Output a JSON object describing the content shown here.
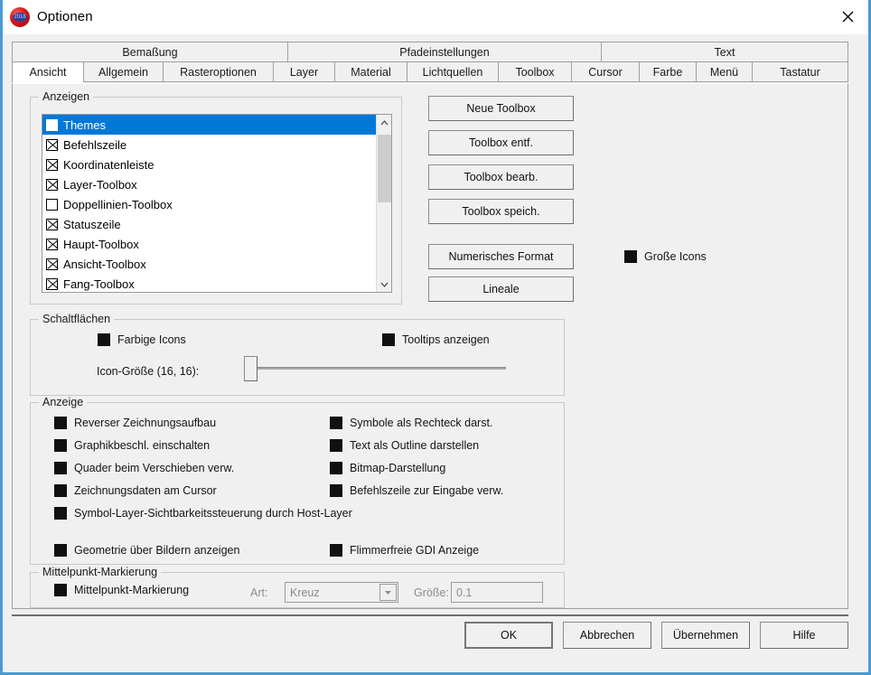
{
  "window": {
    "title": "Optionen",
    "icon": "app-logo-icon",
    "icon_label": "2018",
    "close_label": "close-icon",
    "accent_color": "#4a9bd1"
  },
  "tabs": {
    "row1": [
      {
        "label": "Bemaßung",
        "active": false
      },
      {
        "label": "Pfadeinstellungen",
        "active": false
      },
      {
        "label": "Text",
        "active": false
      }
    ],
    "row2": [
      {
        "label": "Ansicht",
        "active": true
      },
      {
        "label": "Allgemein",
        "active": false
      },
      {
        "label": "Rasteroptionen",
        "active": false
      },
      {
        "label": "Layer",
        "active": false
      },
      {
        "label": "Material",
        "active": false
      },
      {
        "label": "Lichtquellen",
        "active": false
      },
      {
        "label": "Toolbox",
        "active": false
      },
      {
        "label": "Cursor",
        "active": false
      },
      {
        "label": "Farbe",
        "active": false
      },
      {
        "label": "Menü",
        "active": false
      },
      {
        "label": "Tastatur",
        "active": false
      }
    ]
  },
  "anzeigen_group": {
    "title": "Anzeigen",
    "items": [
      {
        "label": "Themes",
        "checked": false,
        "selected": true
      },
      {
        "label": "Befehlszeile",
        "checked": true,
        "selected": false
      },
      {
        "label": "Koordinatenleiste",
        "checked": true,
        "selected": false
      },
      {
        "label": "Layer-Toolbox",
        "checked": true,
        "selected": false
      },
      {
        "label": "Doppellinien-Toolbox",
        "checked": false,
        "selected": false
      },
      {
        "label": "Statuszeile",
        "checked": true,
        "selected": false
      },
      {
        "label": "Haupt-Toolbox",
        "checked": true,
        "selected": false
      },
      {
        "label": "Ansicht-Toolbox",
        "checked": true,
        "selected": false
      },
      {
        "label": "Fang-Toolbox",
        "checked": true,
        "selected": false
      }
    ],
    "scroll_up": "▲",
    "scroll_down": "▼"
  },
  "toolbox_buttons": [
    {
      "label": "Neue Toolbox"
    },
    {
      "label": "Toolbox entf."
    },
    {
      "label": "Toolbox bearb."
    },
    {
      "label": "Toolbox speich."
    },
    {
      "label": "Numerisches Format"
    },
    {
      "label": "Lineale"
    }
  ],
  "grosse_icons": {
    "label": "Große Icons",
    "checked": true
  },
  "schaltflaechen_group": {
    "title": "Schaltflächen",
    "farbige_icons": {
      "label": "Farbige Icons",
      "checked": true
    },
    "tooltips": {
      "label": "Tooltips anzeigen",
      "checked": true
    },
    "icon_size_label": "Icon-Größe (16, 16):",
    "icon_size_value": 16,
    "icon_size_min": 16,
    "icon_size_max": 64
  },
  "anzeige_group": {
    "title": "Anzeige",
    "left_column": [
      {
        "label": "Reverser Zeichnungsaufbau",
        "checked": true
      },
      {
        "label": "Graphikbeschl. einschalten",
        "checked": true
      },
      {
        "label": "Quader beim Verschieben verw.",
        "checked": true
      },
      {
        "label": "Zeichnungsdaten am Cursor",
        "checked": true
      },
      {
        "label": "Symbol-Layer-Sichtbarkeitssteuerung durch Host-Layer",
        "checked": true
      }
    ],
    "right_column": [
      {
        "label": "Symbole als Rechteck darst.",
        "checked": true
      },
      {
        "label": "Text als Outline darstellen",
        "checked": true
      },
      {
        "label": "Bitmap-Darstellung",
        "checked": true
      },
      {
        "label": "Befehlszeile zur Eingabe verw.",
        "checked": true
      }
    ],
    "bottom_left": {
      "label": "Geometrie über Bildern anzeigen",
      "checked": true
    },
    "bottom_right": {
      "label": "Flimmerfreie GDI Anzeige",
      "checked": true
    }
  },
  "mittelpunkt_group": {
    "title": "Mittelpunkt-Markierung",
    "checkbox": {
      "label": "Mittelpunkt-Markierung",
      "checked": true
    },
    "art_label": "Art:",
    "art_value": "Kreuz",
    "art_options": [
      "Kreuz"
    ],
    "groesse_label": "Größe:",
    "groesse_value": "0.1",
    "disabled": true
  },
  "footer": {
    "ok": "OK",
    "cancel": "Abbrechen",
    "apply": "Übernehmen",
    "help": "Hilfe"
  }
}
